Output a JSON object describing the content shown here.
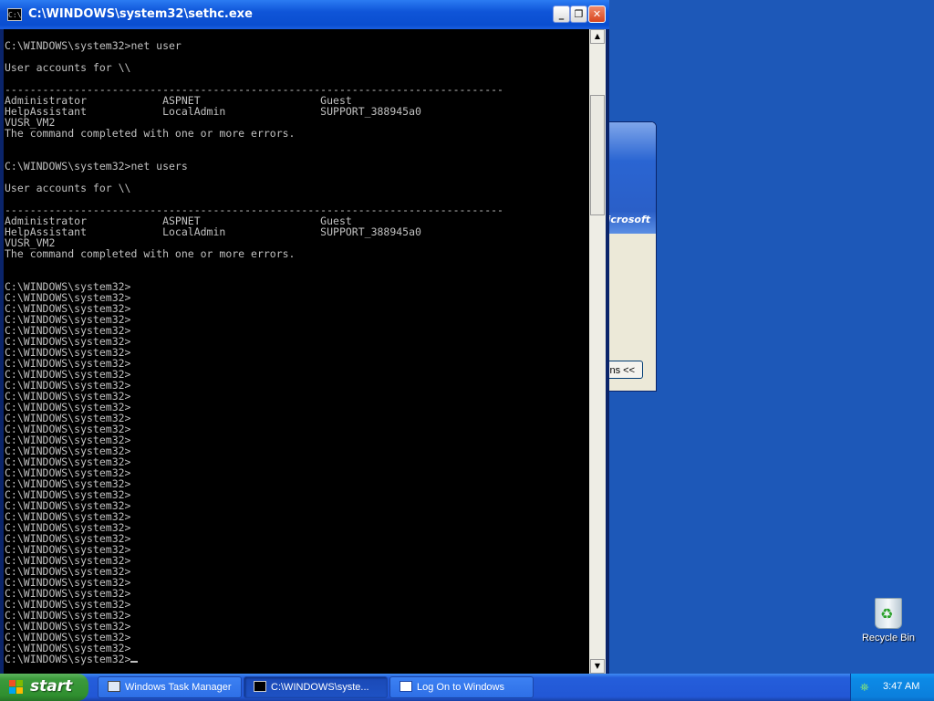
{
  "background_window": {
    "brand_text": "Microsoft",
    "options_button": "ns <<"
  },
  "console": {
    "title": "C:\\WINDOWS\\system32\\sethc.exe",
    "icon_text": "C:\\",
    "buttons": {
      "minimize": "_",
      "restore": "❐",
      "close": "✕"
    },
    "lines": [
      "",
      "C:\\WINDOWS\\system32>net user",
      "",
      "User accounts for \\\\",
      "",
      "-------------------------------------------------------------------------------",
      "Administrator            ASPNET                   Guest",
      "HelpAssistant            LocalAdmin               SUPPORT_388945a0",
      "VUSR_VM2",
      "The command completed with one or more errors.",
      "",
      "",
      "C:\\WINDOWS\\system32>net users",
      "",
      "User accounts for \\\\",
      "",
      "-------------------------------------------------------------------------------",
      "Administrator            ASPNET                   Guest",
      "HelpAssistant            LocalAdmin               SUPPORT_388945a0",
      "VUSR_VM2",
      "The command completed with one or more errors.",
      "",
      "",
      "C:\\WINDOWS\\system32>",
      "C:\\WINDOWS\\system32>",
      "C:\\WINDOWS\\system32>",
      "C:\\WINDOWS\\system32>",
      "C:\\WINDOWS\\system32>",
      "C:\\WINDOWS\\system32>",
      "C:\\WINDOWS\\system32>",
      "C:\\WINDOWS\\system32>",
      "C:\\WINDOWS\\system32>",
      "C:\\WINDOWS\\system32>",
      "C:\\WINDOWS\\system32>",
      "C:\\WINDOWS\\system32>",
      "C:\\WINDOWS\\system32>",
      "C:\\WINDOWS\\system32>",
      "C:\\WINDOWS\\system32>",
      "C:\\WINDOWS\\system32>",
      "C:\\WINDOWS\\system32>",
      "C:\\WINDOWS\\system32>",
      "C:\\WINDOWS\\system32>",
      "C:\\WINDOWS\\system32>",
      "C:\\WINDOWS\\system32>",
      "C:\\WINDOWS\\system32>",
      "C:\\WINDOWS\\system32>",
      "C:\\WINDOWS\\system32>",
      "C:\\WINDOWS\\system32>",
      "C:\\WINDOWS\\system32>",
      "C:\\WINDOWS\\system32>",
      "C:\\WINDOWS\\system32>",
      "C:\\WINDOWS\\system32>",
      "C:\\WINDOWS\\system32>",
      "C:\\WINDOWS\\system32>",
      "C:\\WINDOWS\\system32>",
      "C:\\WINDOWS\\system32>",
      "C:\\WINDOWS\\system32>",
      "C:\\WINDOWS\\system32>"
    ]
  },
  "desktop": {
    "recycle_bin_label": "Recycle Bin"
  },
  "taskbar": {
    "start_label": "start",
    "tasks": [
      {
        "label": "Windows Task Manager",
        "icon": "task-manager-icon",
        "active": false
      },
      {
        "label": "C:\\WINDOWS\\syste...",
        "icon": "console-icon",
        "active": true
      },
      {
        "label": "Log On to Windows",
        "icon": "window-icon",
        "active": false
      }
    ],
    "clock": "3:47 AM"
  },
  "colors": {
    "desktop": "#1d58b8",
    "console_bg": "#000000",
    "console_fg": "#c0c0c0",
    "titlebar": "#0a4ed0",
    "start_green": "#3c9a3c"
  }
}
